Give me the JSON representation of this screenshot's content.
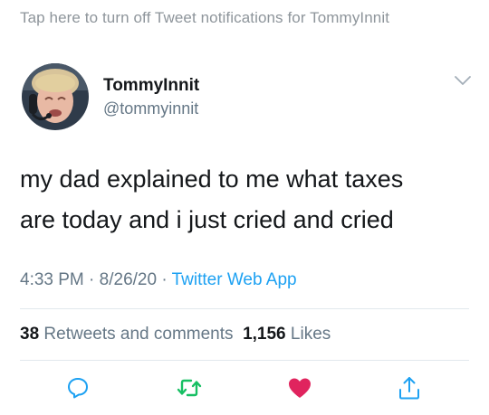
{
  "notification_banner": "Tap here to turn off Tweet notifications for TommyInnit",
  "author": {
    "display_name": "TommyInnit",
    "handle": "@tommyinnit"
  },
  "tweet": {
    "line1": "my dad explained to me what taxes",
    "line2": "are today and i just cried and cried"
  },
  "meta": {
    "time": "4:33 PM",
    "sep1": " · ",
    "date": "8/26/20",
    "sep2": " · ",
    "source": "Twitter Web App"
  },
  "stats": {
    "retweets_count": "38",
    "retweets_label": " Retweets and comments  ",
    "likes_count": "1,156",
    "likes_label": " Likes"
  },
  "actions": {
    "reply_icon": "speech-bubble-icon",
    "retweet_icon": "retweet-icon",
    "like_icon": "heart-icon",
    "share_icon": "share-icon"
  },
  "colors": {
    "link": "#1da1f2",
    "secondary_text": "#657786",
    "retweet_active": "#17bf63",
    "like_active": "#e0245e"
  }
}
